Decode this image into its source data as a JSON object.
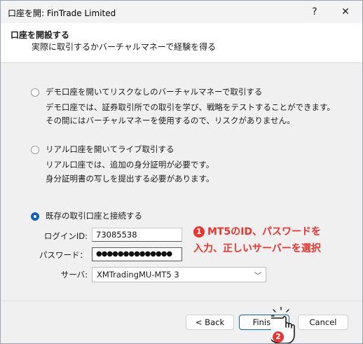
{
  "window": {
    "title": "口座を開: FinTrade Limited",
    "help_label": "?",
    "close_label": "✕"
  },
  "header": {
    "title": "口座を開設する",
    "subtitle": "実際に取引するかバーチャルマネーで経験を得る"
  },
  "options": {
    "demo": {
      "label": "デモ口座を開いてリスクなしのバーチャルマネーで取引する",
      "desc_line1": "デモ口座では、証券取引所での取引を学び、戦略をテストすることができます。",
      "desc_line2": "その間にはバーチャルマネーを使用するので、リスクがありません。",
      "selected": false
    },
    "real": {
      "label": "リアル口座を開いてライブ取引する",
      "desc_line1": "リアル口座では、追加の身分証明が必要です。",
      "desc_line2": "身分証明書の写しを提出する必要があります。",
      "selected": false
    },
    "existing": {
      "label": "既存の取引口座と接続する",
      "selected": true
    }
  },
  "form": {
    "login_label": "ログインID:",
    "login_value": "73085538",
    "password_label": "パスワード：",
    "password_value": "●●●●●●●●●●●●●●",
    "server_label": "サーバ:",
    "server_value": "XMTradingMU-MT5 3"
  },
  "annotations": {
    "note1_number": "1",
    "note1_line1": "MT5のID、パスワードを",
    "note1_line2": "入力、正しいサーバーを選択",
    "note2_number": "2",
    "color": "#e8352f"
  },
  "buttons": {
    "back": "< Back",
    "finish": "Finish",
    "cancel": "Cancel"
  },
  "colors": {
    "accent": "#0f62c4"
  }
}
